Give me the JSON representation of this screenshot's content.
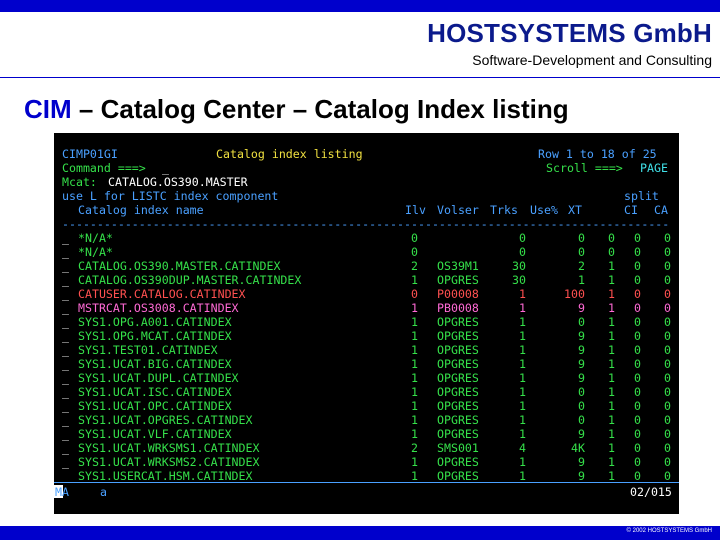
{
  "header": {
    "company": "HOSTSYSTEMS GmbH",
    "tagline": "Software-Development and Consulting"
  },
  "title": {
    "accent": "CIM",
    "rest": " – Catalog Center – Catalog Index listing"
  },
  "terminal": {
    "panel_id": "CIMP01GI",
    "panel_title": "Catalog index listing",
    "row_info": "Row 1 to 18 of 25",
    "command_label": "Command ===>",
    "command_value": "_",
    "scroll_label": "Scroll ===>",
    "scroll_value": "PAGE",
    "mcat_label": "Mcat:",
    "mcat_value": "CATALOG.OS390.MASTER",
    "hint": "use L for LISTC index component",
    "split_label": "split",
    "columns": {
      "name": "Catalog index name",
      "lvl": "Ilv",
      "volser": "Volser",
      "trks": "Trks",
      "use": "Use%",
      "xt": "XT",
      "ci": "CI",
      "ca": "CA"
    },
    "rows": [
      {
        "sel": "_",
        "name": "*N/A*",
        "lvl": "0",
        "volser": "",
        "trks": "0",
        "use": "0",
        "xt": "0",
        "ci": "0",
        "ca": "0"
      },
      {
        "sel": "_",
        "name": "*N/A*",
        "lvl": "0",
        "volser": "",
        "trks": "0",
        "use": "0",
        "xt": "0",
        "ci": "0",
        "ca": "0"
      },
      {
        "sel": "_",
        "name": "CATALOG.OS390.MASTER.CATINDEX",
        "lvl": "2",
        "volser": "OS39M1",
        "trks": "30",
        "use": "2",
        "xt": "1",
        "ci": "0",
        "ca": "0"
      },
      {
        "sel": "_",
        "name": "CATALOG.OS390DUP.MASTER.CATINDEX",
        "lvl": "1",
        "volser": "OPGRES",
        "trks": "30",
        "use": "1",
        "xt": "1",
        "ci": "0",
        "ca": "0"
      },
      {
        "sel": "_",
        "name": "CATUSER.CATALOG.CATINDEX",
        "lvl": "0",
        "volser": "P00008",
        "trks": "1",
        "use": "100",
        "xt": "1",
        "ci": "0",
        "ca": "0"
      },
      {
        "sel": "_",
        "name": "MSTRCAT.OS3008.CATINDEX",
        "lvl": "1",
        "volser": "PB0008",
        "trks": "1",
        "use": "9",
        "xt": "1",
        "ci": "0",
        "ca": "0"
      },
      {
        "sel": "_",
        "name": "SYS1.OPG.A001.CATINDEX",
        "lvl": "1",
        "volser": "OPGRES",
        "trks": "1",
        "use": "0",
        "xt": "1",
        "ci": "0",
        "ca": "0"
      },
      {
        "sel": "_",
        "name": "SYS1.OPG.MCAT.CATINDEX",
        "lvl": "1",
        "volser": "OPGRES",
        "trks": "1",
        "use": "9",
        "xt": "1",
        "ci": "0",
        "ca": "0"
      },
      {
        "sel": "_",
        "name": "SYS1.TEST01.CATINDEX",
        "lvl": "1",
        "volser": "OPGRES",
        "trks": "1",
        "use": "9",
        "xt": "1",
        "ci": "0",
        "ca": "0"
      },
      {
        "sel": "_",
        "name": "SYS1.UCAT.BIG.CATINDEX",
        "lvl": "1",
        "volser": "OPGRES",
        "trks": "1",
        "use": "9",
        "xt": "1",
        "ci": "0",
        "ca": "0"
      },
      {
        "sel": "_",
        "name": "SYS1.UCAT.DUPL.CATINDEX",
        "lvl": "1",
        "volser": "OPGRES",
        "trks": "1",
        "use": "9",
        "xt": "1",
        "ci": "0",
        "ca": "0"
      },
      {
        "sel": "_",
        "name": "SYS1.UCAT.ISC.CATINDEX",
        "lvl": "1",
        "volser": "OPGRES",
        "trks": "1",
        "use": "0",
        "xt": "1",
        "ci": "0",
        "ca": "0"
      },
      {
        "sel": "_",
        "name": "SYS1.UCAT.OPC.CATINDEX",
        "lvl": "1",
        "volser": "OPGRES",
        "trks": "1",
        "use": "0",
        "xt": "1",
        "ci": "0",
        "ca": "0"
      },
      {
        "sel": "_",
        "name": "SYS1.UCAT.OPGRES.CATINDEX",
        "lvl": "1",
        "volser": "OPGRES",
        "trks": "1",
        "use": "0",
        "xt": "1",
        "ci": "0",
        "ca": "0"
      },
      {
        "sel": "_",
        "name": "SYS1.UCAT.VLF.CATINDEX",
        "lvl": "1",
        "volser": "OPGRES",
        "trks": "1",
        "use": "9",
        "xt": "1",
        "ci": "0",
        "ca": "0"
      },
      {
        "sel": "_",
        "name": "SYS1.UCAT.WRKSMS1.CATINDEX",
        "lvl": "2",
        "volser": "SMS001",
        "trks": "4",
        "use": "4K",
        "xt": "1",
        "ci": "0",
        "ca": "0"
      },
      {
        "sel": "_",
        "name": "SYS1.UCAT.WRKSMS2.CATINDEX",
        "lvl": "1",
        "volser": "OPGRES",
        "trks": "1",
        "use": "9",
        "xt": "1",
        "ci": "0",
        "ca": "0"
      },
      {
        "sel": "_",
        "name": "SYS1.USERCAT.HSM.CATINDEX",
        "lvl": "1",
        "volser": "OPGRES",
        "trks": "1",
        "use": "9",
        "xt": "1",
        "ci": "0",
        "ca": "0"
      }
    ],
    "status": {
      "session": "MA",
      "indicator": "a",
      "position": "02/015"
    }
  },
  "footer": {
    "copyright": "© 2002 HOSTSYSTEMS GmbH"
  }
}
